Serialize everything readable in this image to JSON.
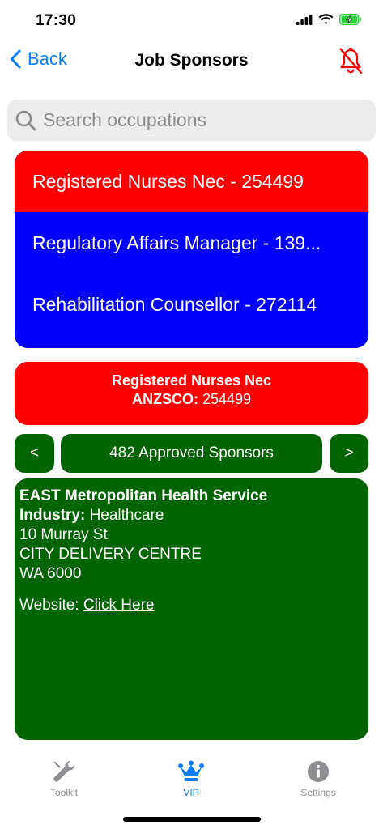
{
  "status_bar": {
    "time": "17:30",
    "battery_level": 0.8
  },
  "nav": {
    "back_label": "Back",
    "title": "Job Sponsors"
  },
  "search": {
    "placeholder": "Search occupations",
    "value": ""
  },
  "results": [
    {
      "label": "Registered Nurses Nec - 254499",
      "selected": true
    },
    {
      "label": "Regulatory Affairs Manager - 139...",
      "selected": false
    },
    {
      "label": "Rehabilitation Counsellor - 272114",
      "selected": false
    }
  ],
  "selected_occupation": {
    "name": "Registered Nurses Nec",
    "anzsco_label": "ANZSCO:",
    "anzsco_code": "254499"
  },
  "pager": {
    "prev_label": "<",
    "count_label": "482 Approved Sponsors",
    "next_label": ">"
  },
  "sponsor": {
    "name": "EAST Metropolitan Health Service",
    "industry_label": "Industry:",
    "industry": "Healthcare",
    "address_line1": "10 Murray St",
    "address_line2": "CITY DELIVERY CENTRE",
    "address_line3": "WA 6000",
    "website_label": "Website:",
    "website_link": "Click Here"
  },
  "tabs": [
    {
      "label": "Toolkit",
      "icon": "wrench-icon",
      "active": false
    },
    {
      "label": "VIP",
      "icon": "crown-icon",
      "active": true
    },
    {
      "label": "Settings",
      "icon": "info-icon",
      "active": false
    }
  ],
  "colors": {
    "accent_blue": "#0a7cff",
    "selected_red": "#ff0000",
    "list_blue": "#0000ff",
    "card_green": "#006400",
    "bell_red": "#ff0000"
  }
}
